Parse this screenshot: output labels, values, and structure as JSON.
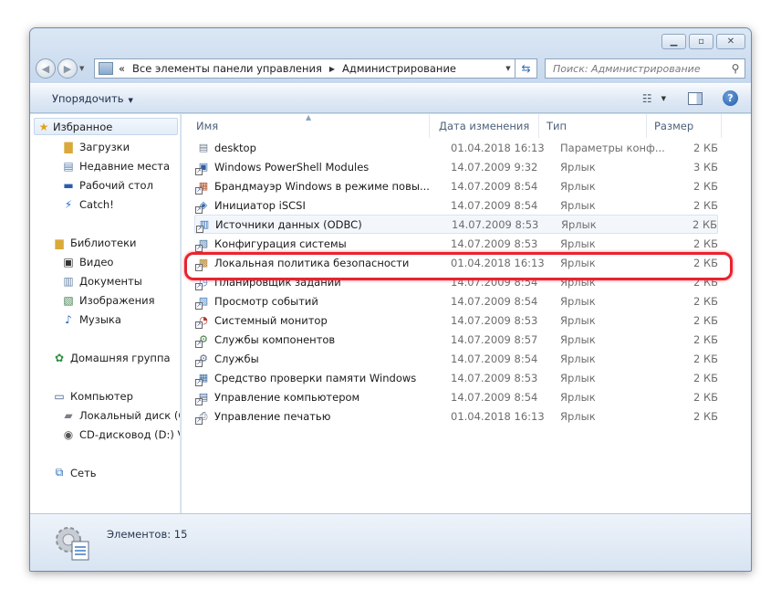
{
  "address": {
    "back_chevrons": "«",
    "crumbs": [
      "Все элементы панели управления",
      "Администрирование"
    ]
  },
  "search": {
    "placeholder": "Поиск: Администрирование"
  },
  "toolbar": {
    "organize_label": "Упорядочить"
  },
  "nav": {
    "favorites": "Избранное",
    "favorites_items": [
      "Загрузки",
      "Недавние места",
      "Рабочий стол",
      "Catch!"
    ],
    "libraries": "Библиотеки",
    "libraries_items": [
      "Видео",
      "Документы",
      "Изображения",
      "Музыка"
    ],
    "homegroup": "Домашняя группа",
    "computer": "Компьютер",
    "computer_items": [
      "Локальный диск (C",
      "CD-дисковод (D:) Vi"
    ],
    "network": "Сеть"
  },
  "columns": {
    "name": "Имя",
    "date": "Дата изменения",
    "type": "Тип",
    "size": "Размер"
  },
  "files": [
    {
      "name": "desktop",
      "date": "01.04.2018 16:13",
      "type": "Параметры конф...",
      "size": "2 КБ",
      "icon": "settings-file-icon"
    },
    {
      "name": "Windows PowerShell Modules",
      "date": "14.07.2009 9:32",
      "type": "Ярлык",
      "size": "3 КБ",
      "icon": "powershell-icon"
    },
    {
      "name": "Брандмауэр Windows в режиме повы...",
      "date": "14.07.2009 8:54",
      "type": "Ярлык",
      "size": "2 КБ",
      "icon": "firewall-icon"
    },
    {
      "name": "Инициатор iSCSI",
      "date": "14.07.2009 8:54",
      "type": "Ярлык",
      "size": "2 КБ",
      "icon": "iscsi-icon"
    },
    {
      "name": "Источники данных (ODBC)",
      "date": "14.07.2009 8:53",
      "type": "Ярлык",
      "size": "2 КБ",
      "icon": "odbc-icon"
    },
    {
      "name": "Конфигурация системы",
      "date": "14.07.2009 8:53",
      "type": "Ярлык",
      "size": "2 КБ",
      "icon": "msconfig-icon"
    },
    {
      "name": "Локальная политика безопасности",
      "date": "01.04.2018 16:13",
      "type": "Ярлык",
      "size": "2 КБ",
      "icon": "security-policy-icon"
    },
    {
      "name": "Планировщик заданий",
      "date": "14.07.2009 8:54",
      "type": "Ярлык",
      "size": "2 КБ",
      "icon": "task-scheduler-icon"
    },
    {
      "name": "Просмотр событий",
      "date": "14.07.2009 8:54",
      "type": "Ярлык",
      "size": "2 КБ",
      "icon": "event-viewer-icon"
    },
    {
      "name": "Системный монитор",
      "date": "14.07.2009 8:53",
      "type": "Ярлык",
      "size": "2 КБ",
      "icon": "performance-monitor-icon"
    },
    {
      "name": "Службы компонентов",
      "date": "14.07.2009 8:57",
      "type": "Ярлык",
      "size": "2 КБ",
      "icon": "component-services-icon"
    },
    {
      "name": "Службы",
      "date": "14.07.2009 8:54",
      "type": "Ярлык",
      "size": "2 КБ",
      "icon": "services-icon"
    },
    {
      "name": "Средство проверки памяти Windows",
      "date": "14.07.2009 8:53",
      "type": "Ярлык",
      "size": "2 КБ",
      "icon": "memory-diagnostic-icon"
    },
    {
      "name": "Управление компьютером",
      "date": "14.07.2009 8:54",
      "type": "Ярлык",
      "size": "2 КБ",
      "icon": "computer-management-icon"
    },
    {
      "name": "Управление печатью",
      "date": "01.04.2018 16:13",
      "type": "Ярлык",
      "size": "2 КБ",
      "icon": "print-management-icon"
    }
  ],
  "status": {
    "count_text": "Элементов: 15"
  },
  "colors": {
    "highlight": "#e8242f",
    "accent": "#2c6bb3"
  }
}
